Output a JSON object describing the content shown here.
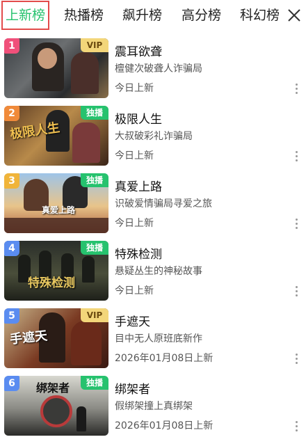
{
  "tabs": [
    {
      "label": "上新榜",
      "active": true
    },
    {
      "label": "热播榜",
      "active": false
    },
    {
      "label": "飙升榜",
      "active": false
    },
    {
      "label": "高分榜",
      "active": false
    },
    {
      "label": "科幻榜",
      "active": false
    }
  ],
  "close_icon": "close-icon",
  "colors": {
    "accent": "#26c26e",
    "active_border": "#e24b4b",
    "vip": "#f3d67a"
  },
  "items": [
    {
      "rank": "1",
      "rank_color": "#f0507a",
      "badge": "VIP",
      "badge_type": "vip",
      "title": "震耳欲聋",
      "desc": "檀健次破聋人诈骗局",
      "date": "今日上新",
      "poster_text": ""
    },
    {
      "rank": "2",
      "rank_color": "#f08a3a",
      "badge": "独播",
      "badge_type": "solo",
      "title": "极限人生",
      "desc": "大叔破彩礼诈骗局",
      "date": "今日上新",
      "poster_text": "极限人生"
    },
    {
      "rank": "3",
      "rank_color": "#f0b43a",
      "badge": "独播",
      "badge_type": "solo",
      "title": "真爱上路",
      "desc": "识破爱情骗局寻爱之旅",
      "date": "今日上新",
      "poster_text": "真爱上路"
    },
    {
      "rank": "4",
      "rank_color": "#5a8cf0",
      "badge": "独播",
      "badge_type": "solo",
      "title": "特殊检测",
      "desc": "悬疑丛生的神秘故事",
      "date": "今日上新",
      "poster_text": "特殊检测"
    },
    {
      "rank": "5",
      "rank_color": "#5a8cf0",
      "badge": "VIP",
      "badge_type": "vip",
      "title": "手遮天",
      "desc": "目中无人原班底新作",
      "date": "2026年01月08日上新",
      "poster_text": "手遮天"
    },
    {
      "rank": "6",
      "rank_color": "#5a8cf0",
      "badge": "独播",
      "badge_type": "solo",
      "title": "绑架者",
      "desc": "假绑架撞上真绑架",
      "date": "2026年01月08日上新",
      "poster_text": "绑架者"
    }
  ]
}
